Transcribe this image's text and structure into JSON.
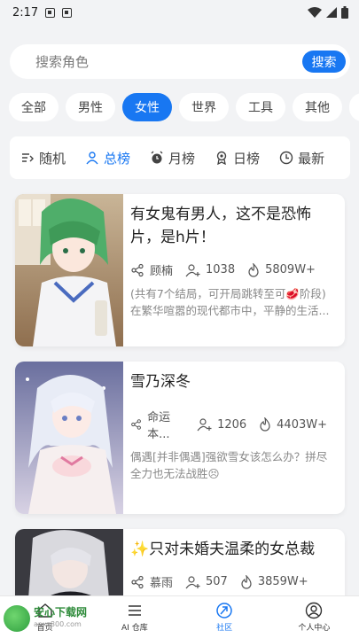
{
  "status": {
    "time": "2:17"
  },
  "search": {
    "placeholder": "搜索角色",
    "button": "搜索"
  },
  "categories": [
    {
      "label": "全部",
      "active": false
    },
    {
      "label": "男性",
      "active": false
    },
    {
      "label": "女性",
      "active": true
    },
    {
      "label": "世界",
      "active": false
    },
    {
      "label": "工具",
      "active": false
    },
    {
      "label": "其他",
      "active": false
    }
  ],
  "rank_tabs": [
    {
      "label": "随机",
      "icon": "shuffle-list-icon",
      "active": false
    },
    {
      "label": "总榜",
      "icon": "user-icon",
      "active": true
    },
    {
      "label": "月榜",
      "icon": "alarm-clock-icon",
      "active": false
    },
    {
      "label": "日榜",
      "icon": "medal-icon",
      "active": false
    },
    {
      "label": "最新",
      "icon": "clock-icon",
      "active": false
    }
  ],
  "cards": [
    {
      "title": "有女鬼有男人，这不是恐怖片，是h片！",
      "author": "顾楠",
      "followers": "1038",
      "heat": "5809W+",
      "description": "(共有7个结局，可开局跳转至可🥩阶段)在繁华喧嚣的现代都市中，平静的生活..."
    },
    {
      "title": "雪乃深冬",
      "author": "命运本...",
      "followers": "1206",
      "heat": "4403W+",
      "description": "偶遇[并非偶遇]强欲雪女该怎么办？拼尽全力也无法战胜😣"
    },
    {
      "title": "✨只对未婚夫温柔的女总裁",
      "author": "慕雨",
      "followers": "507",
      "heat": "3859W+",
      "description": ""
    }
  ],
  "bottom_nav": [
    {
      "label": "首页",
      "icon": "home-icon",
      "active": false
    },
    {
      "label": "AI 仓库",
      "icon": "list-icon",
      "active": false
    },
    {
      "label": "社区",
      "icon": "community-icon",
      "active": true
    },
    {
      "label": "个人中心",
      "icon": "profile-icon",
      "active": false
    }
  ],
  "watermark": {
    "main": "安心下载网",
    "sub": "anxz800.com"
  },
  "colors": {
    "accent": "#1877f2",
    "background": "#f2f3f5"
  }
}
